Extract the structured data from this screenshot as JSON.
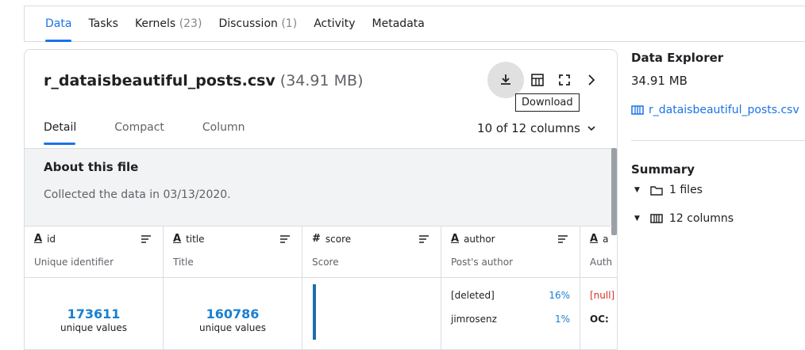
{
  "top_tabs": [
    {
      "label": "Data",
      "count": ""
    },
    {
      "label": "Tasks",
      "count": ""
    },
    {
      "label": "Kernels",
      "count": "(23)"
    },
    {
      "label": "Discussion",
      "count": "(1)"
    },
    {
      "label": "Activity",
      "count": ""
    },
    {
      "label": "Metadata",
      "count": ""
    }
  ],
  "file": {
    "name": "r_dataisbeautiful_posts.csv",
    "size": "(34.91 MB)"
  },
  "actions": {
    "tooltip": "Download"
  },
  "sub_tabs": [
    "Detail",
    "Compact",
    "Column"
  ],
  "column_selector": "10 of 12 columns",
  "about": {
    "title": "About this file",
    "text": "Collected the data in 03/13/2020."
  },
  "columns": [
    {
      "type_icon": "A",
      "name": "id",
      "desc": "Unique identifier",
      "big": "173611",
      "big_sub": "unique values"
    },
    {
      "type_icon": "A",
      "name": "title",
      "desc": "Title",
      "big": "160786",
      "big_sub": "unique values"
    },
    {
      "type_icon": "#",
      "name": "score",
      "desc": "Score"
    },
    {
      "type_icon": "A",
      "name": "author",
      "desc": "Post's author",
      "values": [
        {
          "label": "[deleted]",
          "pct": "16%"
        },
        {
          "label": "jimrosenz",
          "pct": "1%"
        }
      ]
    },
    {
      "type_icon": "A",
      "name": "a",
      "desc": "Auth",
      "values": [
        {
          "label": "[null]"
        },
        {
          "label": "OC: "
        }
      ]
    }
  ],
  "right_panel": {
    "title": "Data Explorer",
    "size": "34.91 MB",
    "file": "r_dataisbeautiful_posts.csv",
    "summary_title": "Summary",
    "summary": [
      {
        "label": "1 files",
        "icon": "folder-icon"
      },
      {
        "label": "12 columns",
        "icon": "columns-icon"
      }
    ]
  },
  "colors": {
    "accent": "#1a73e8",
    "pct": "#1a7fd1",
    "null": "#d93025"
  }
}
